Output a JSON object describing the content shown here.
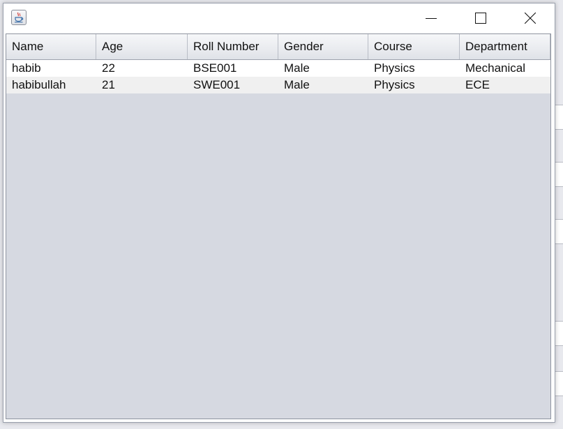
{
  "window": {
    "icon": "java-cup-icon",
    "controls": {
      "minimize": "minimize-icon",
      "maximize": "maximize-icon",
      "close": "close-icon"
    }
  },
  "table": {
    "columns": [
      "Name",
      "Age",
      "Roll Number",
      "Gender",
      "Course",
      "Department"
    ],
    "rows": [
      [
        "habib",
        "22",
        "BSE001",
        "Male",
        "Physics",
        "Mechanical"
      ],
      [
        "habibullah",
        "21",
        "SWE001",
        "Male",
        "Physics",
        "ECE"
      ]
    ]
  },
  "colors": {
    "table_background": "#d6d9e1",
    "row_odd": "#ffffff",
    "row_even": "#f0f0f0",
    "header": "#e9ebef"
  }
}
